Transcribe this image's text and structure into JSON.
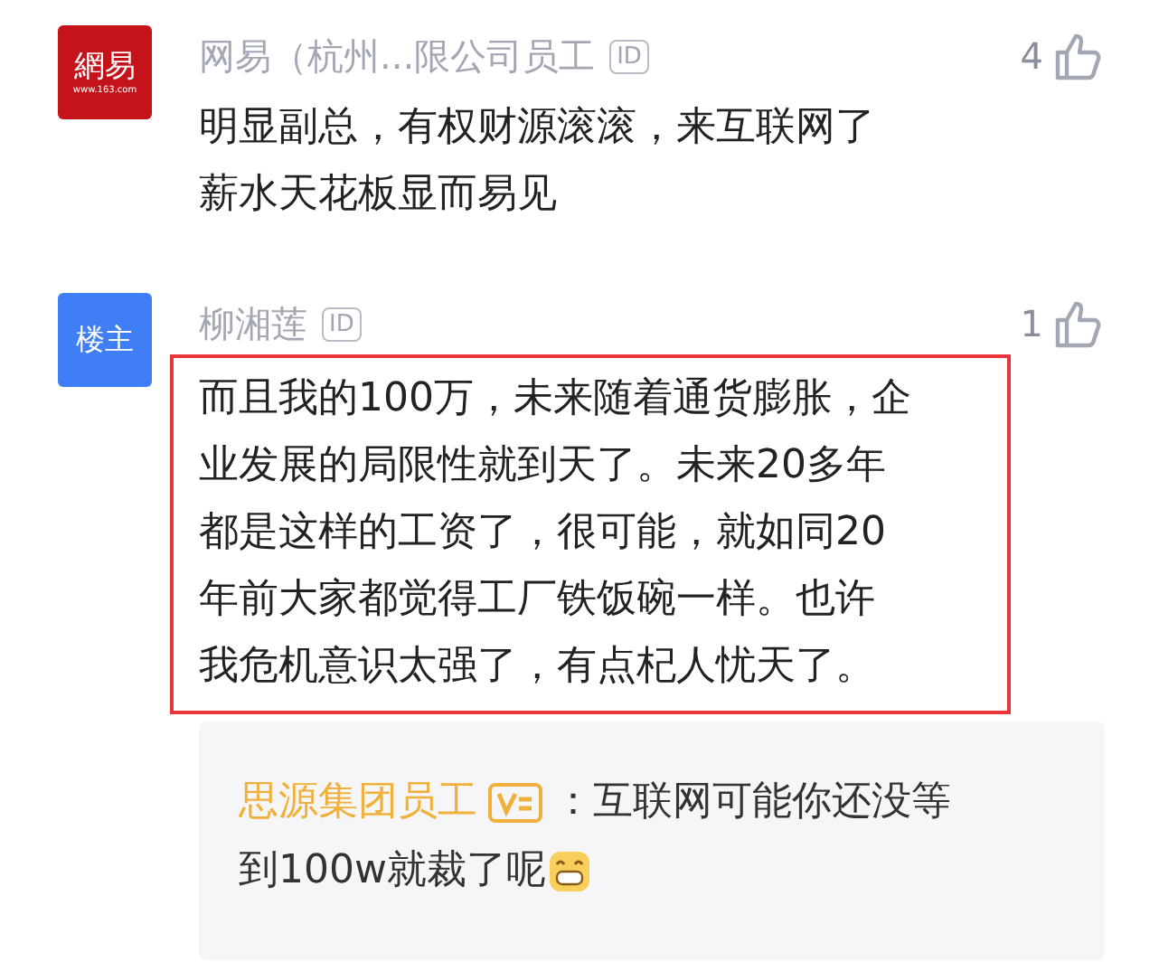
{
  "comments": [
    {
      "avatar": {
        "kind": "logo",
        "text": "網易",
        "subtext": "www.163.com"
      },
      "author": "网易（杭州...限公司员工",
      "badge": "ID",
      "likes": "4",
      "highlighted": false,
      "lines": [
        "明显副总，有权财源滚滚，来互联网了",
        "薪水天花板显而易见"
      ]
    },
    {
      "avatar": {
        "kind": "label",
        "text": "楼主"
      },
      "author": "柳湘莲",
      "badge": "ID",
      "likes": "1",
      "highlighted": true,
      "lines": [
        "而且我的100万，未来随着通货膨胀，企",
        "业发展的局限性就到天了。未来20多年",
        "都是这样的工资了，很可能，就如同20",
        "年前大家都觉得工厂铁饭碗一样。也许",
        "我危机意识太强了，有点杞人忧天了。"
      ],
      "reply": {
        "author": "思源集团员工",
        "lines": [
          "：互联网可能你还没等",
          "到100w就裁了呢"
        ]
      }
    }
  ]
}
